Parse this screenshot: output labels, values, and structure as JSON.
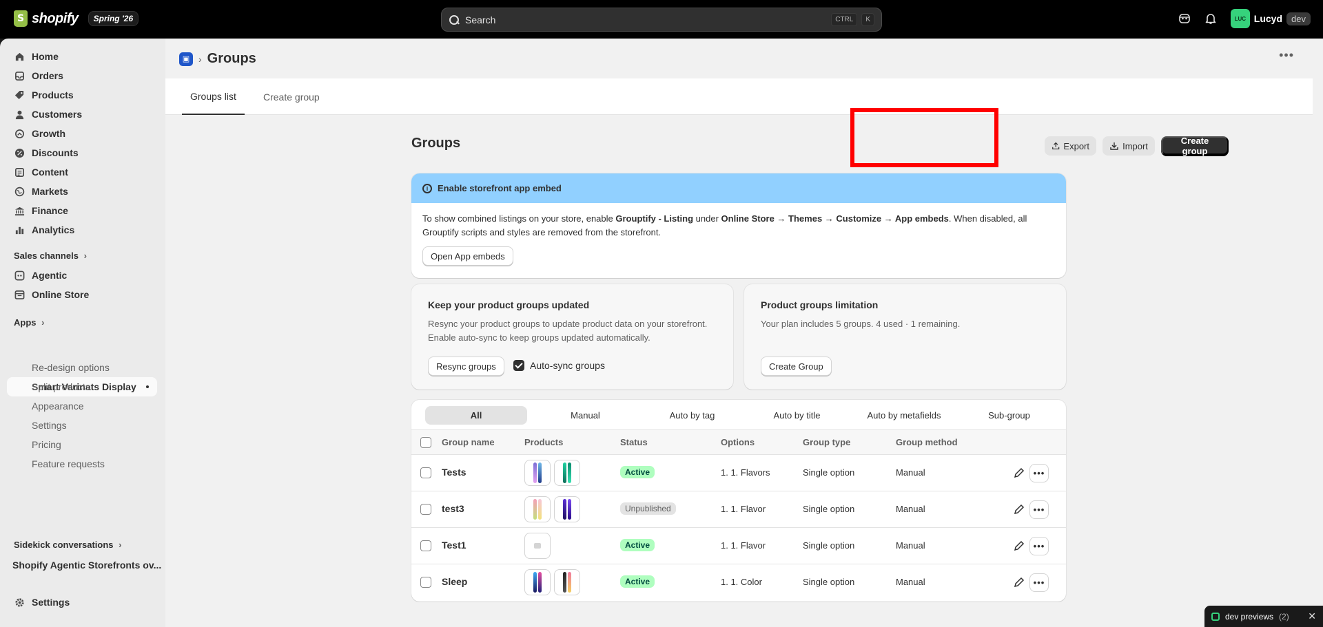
{
  "topbar": {
    "brand": "shopify",
    "edition": "Spring '26",
    "search_label": "Search",
    "shortcut_ctrl": "CTRL",
    "shortcut_key": "K",
    "avatar_initials": "LUC",
    "user_name": "Lucyd",
    "user_badge": "dev"
  },
  "sidebar": {
    "items": [
      {
        "label": "Home",
        "icon": "home-icon"
      },
      {
        "label": "Orders",
        "icon": "orders-icon"
      },
      {
        "label": "Products",
        "icon": "tag-icon"
      },
      {
        "label": "Customers",
        "icon": "person-icon"
      },
      {
        "label": "Growth",
        "icon": "growth-icon"
      },
      {
        "label": "Discounts",
        "icon": "discount-icon"
      },
      {
        "label": "Content",
        "icon": "content-icon"
      },
      {
        "label": "Markets",
        "icon": "globe-icon"
      },
      {
        "label": "Finance",
        "icon": "bank-icon"
      },
      {
        "label": "Analytics",
        "icon": "bar-chart-icon"
      }
    ],
    "sales_channels_label": "Sales channels",
    "channels": [
      {
        "label": "Agentic",
        "icon": "agentic-icon"
      },
      {
        "label": "Online Store",
        "icon": "store-icon"
      }
    ],
    "apps_label": "Apps",
    "active_app": "Smart Varinats Display",
    "app_subitems": [
      "Re-design options",
      "Split products",
      "Appearance",
      "Settings",
      "Pricing",
      "Feature requests"
    ],
    "sidekick_label": "Sidekick conversations",
    "sidekick_item": "Shopify Agentic Storefronts ov...",
    "settings_label": "Settings"
  },
  "page": {
    "title": "Groups",
    "tabs": [
      "Groups list",
      "Create group"
    ]
  },
  "groups": {
    "title": "Groups",
    "export_label": "Export",
    "import_label": "Import",
    "create_label": "Create group"
  },
  "banner": {
    "title": "Enable storefront app embed",
    "text_1": "To show combined listings on your store, enable ",
    "app_name": "Grouptify - Listing",
    "text_2": " under ",
    "path": "Online Store → Themes → Customize → App embeds",
    "text_3": ". When disabled, all Grouptify scripts and styles are removed from the storefront.",
    "button": "Open App embeds"
  },
  "resync_card": {
    "title": "Keep your product groups updated",
    "text": "Resync your product groups to update product data on your storefront. Enable auto-sync to keep groups updated automatically.",
    "button": "Resync groups",
    "checkbox_label": "Auto-sync groups",
    "checked": true
  },
  "limit_card": {
    "title": "Product groups limitation",
    "text": "Your plan includes 5 groups. 4 used · 1 remaining.",
    "button": "Create Group"
  },
  "table": {
    "filters": [
      "All",
      "Manual",
      "Auto by tag",
      "Auto by title",
      "Auto by metafields",
      "Sub-group"
    ],
    "active_filter": "All",
    "headers": {
      "name": "Group name",
      "products": "Products",
      "status": "Status",
      "options": "Options",
      "type": "Group type",
      "method": "Group method"
    },
    "rows": [
      {
        "name": "Tests",
        "status": "Active",
        "options": "1. 1. Flavors",
        "type": "Single option",
        "method": "Manual"
      },
      {
        "name": "test3",
        "status": "Unpublished",
        "options": "1. 1. Flavor",
        "type": "Single option",
        "method": "Manual"
      },
      {
        "name": "Test1",
        "status": "Active",
        "options": "1. 1. Flavor",
        "type": "Single option",
        "method": "Manual"
      },
      {
        "name": "Sleep",
        "status": "Active",
        "options": "1. 1. Color",
        "type": "Single option",
        "method": "Manual"
      }
    ]
  },
  "dev_previews": {
    "label": "dev previews",
    "count": "(2)"
  }
}
